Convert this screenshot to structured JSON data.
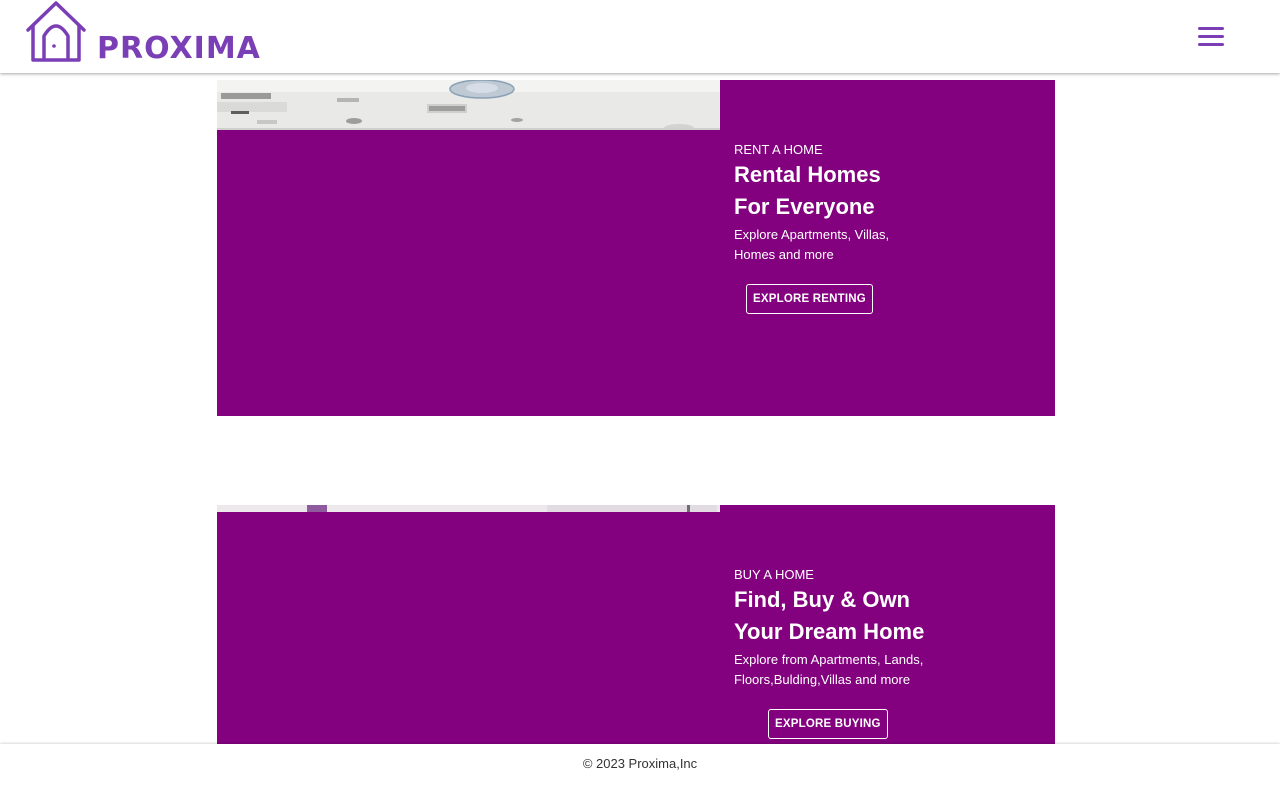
{
  "header": {
    "brand": "PROXIMA",
    "logo_icon": "house-icon",
    "menu_icon": "hamburger-menu-icon",
    "brand_color": "#7b3fb5"
  },
  "sections": [
    {
      "kicker": "RENT A HOME",
      "title_line1": "Rental Homes",
      "title_line2": "For Everyone",
      "desc_line1": "Explore Apartments, Villas,",
      "desc_line2": "Homes and more",
      "cta": "EXPLORE RENTING",
      "bg_color": "#83007e"
    },
    {
      "kicker": "BUY A HOME",
      "title_line1": "Find, Buy & Own",
      "title_line2": "Your Dream Home",
      "desc_line1": "Explore from Apartments, Lands,",
      "desc_line2": "Floors,Bulding,Villas and more",
      "cta": "EXPLORE BUYING",
      "bg_color": "#83007e"
    }
  ],
  "footer": {
    "copyright": "© 2023 Proxima,Inc"
  }
}
